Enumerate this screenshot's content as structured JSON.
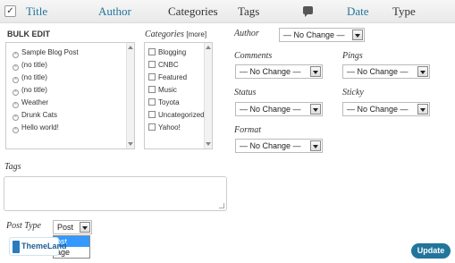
{
  "header": {
    "checkbox_mark": "✓",
    "columns": [
      "Title",
      "Author",
      "Categories",
      "Tags",
      "Date",
      "Type"
    ]
  },
  "bulk_edit": {
    "title": "BULK EDIT",
    "posts": [
      "Sample Blog Post",
      "(no title)",
      "(no title)",
      "(no title)",
      "Weather",
      "Drunk Cats",
      "Hello world!"
    ]
  },
  "categories": {
    "title": "Categories",
    "more": "[more]",
    "items": [
      "Blogging",
      "CNBC",
      "Featured",
      "Music",
      "Toyota",
      "Uncategorized",
      "Yahoo!"
    ]
  },
  "fields": {
    "author_label": "Author",
    "author_value": "— No Change —",
    "comments_label": "Comments",
    "comments_value": "— No Change —",
    "pings_label": "Pings",
    "pings_value": "— No Change —",
    "status_label": "Status",
    "status_value": "— No Change —",
    "sticky_label": "Sticky",
    "sticky_value": "— No Change —",
    "format_label": "Format",
    "format_value": "— No Change —"
  },
  "tags": {
    "label": "Tags",
    "value": ""
  },
  "post_type": {
    "label": "Post Type",
    "value": "Post",
    "options": [
      "Post",
      "Page"
    ],
    "options_visible_text": [
      "ost",
      "age"
    ]
  },
  "watermark": {
    "text": "ThemeLand"
  },
  "update_button": "Update",
  "colors": {
    "link": "#21759b",
    "button": "#21759b",
    "highlight": "#3399ff"
  }
}
